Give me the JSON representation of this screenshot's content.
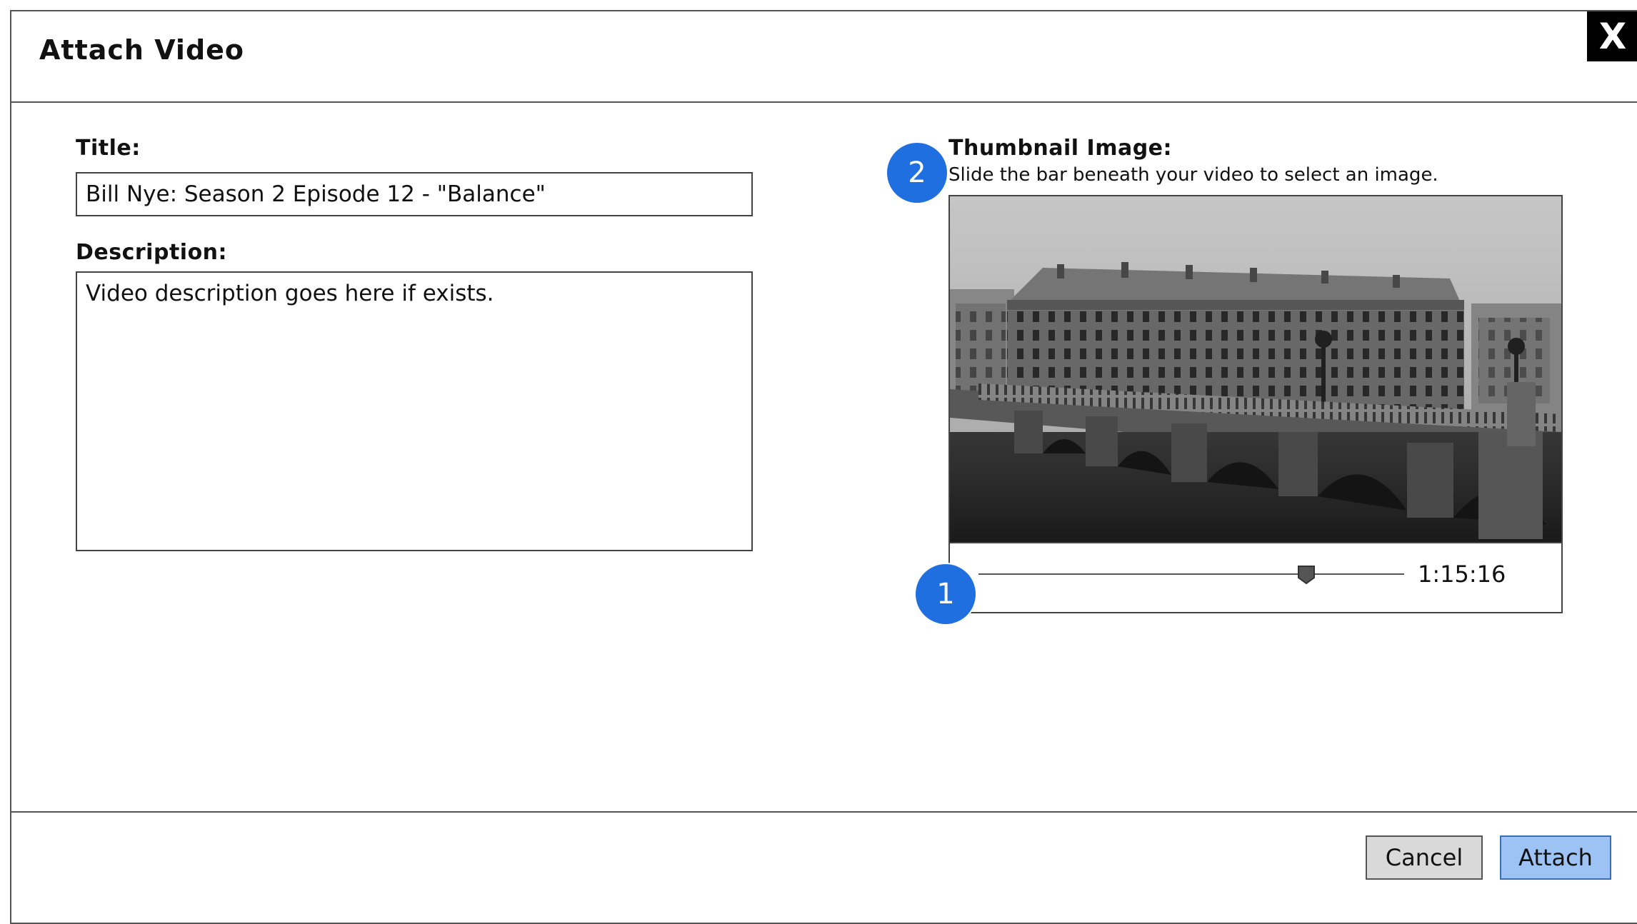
{
  "dialog": {
    "title": "Attach Video",
    "close_label": "X"
  },
  "form": {
    "title_label": "Title:",
    "title_value": "Bill Nye: Season 2 Episode 12 - \"Balance\"",
    "description_label": "Description:",
    "description_value": "Video description goes here if exists."
  },
  "thumbnail": {
    "label": "Thumbnail Image:",
    "hint": "Slide the bar beneath your video to select an image.",
    "time": "1:15:16",
    "slider_position_fraction": 0.77
  },
  "annotations": {
    "badge_1": "1",
    "badge_2": "2",
    "badge_color": "#1f6fe0"
  },
  "footer": {
    "cancel_label": "Cancel",
    "attach_label": "Attach",
    "attach_color": "#9cc3f4"
  }
}
